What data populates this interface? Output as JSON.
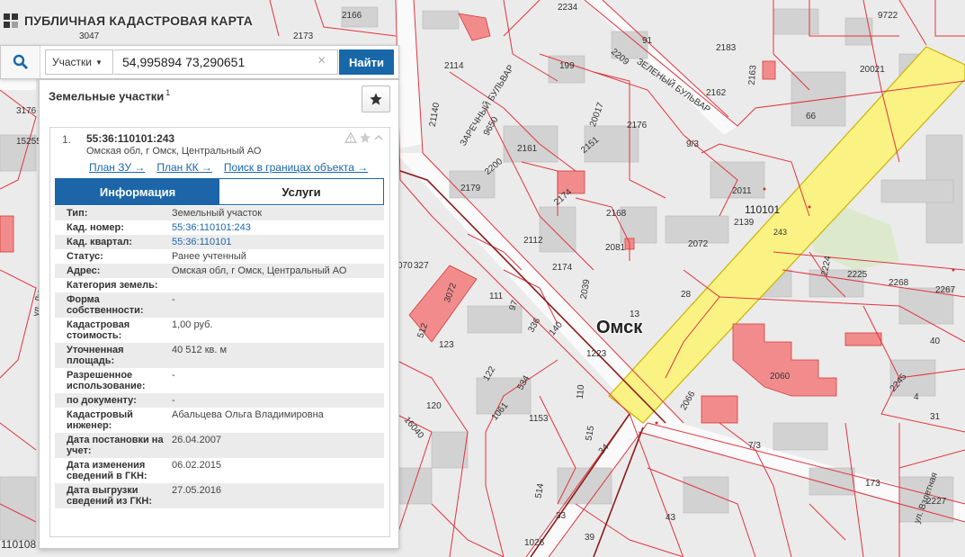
{
  "app": {
    "title": "ПУБЛИЧНАЯ КАДАСТРОВАЯ КАРТА"
  },
  "search": {
    "type_label": "Участки",
    "value": "54,995894 73,290651",
    "clear_symbol": "×",
    "button_label": "Найти"
  },
  "panel": {
    "title": "Земельные участки",
    "count": "1",
    "result": {
      "number": "1.",
      "cad_number": "55:36:110101:243",
      "address": "Омская обл, г Омск, Центральный АО",
      "links": [
        "План ЗУ →",
        "План КК →",
        "Поиск в границах объекта →"
      ],
      "tabs": [
        "Информация",
        "Услуги"
      ],
      "rows": [
        {
          "label": "Тип:",
          "value": "Земельный участок",
          "link": false
        },
        {
          "label": "Кад. номер:",
          "value": "55:36:110101:243",
          "link": true
        },
        {
          "label": "Кад. квартал:",
          "value": "55:36:110101",
          "link": true
        },
        {
          "label": "Статус:",
          "value": "Ранее учтенный",
          "link": false
        },
        {
          "label": "Адрес:",
          "value": "Омская обл, г Омск, Центральный АО",
          "link": false
        },
        {
          "label": "Категория земель:",
          "value": "",
          "link": false
        },
        {
          "label": "Форма собственности:",
          "value": "-",
          "link": false
        },
        {
          "label": "Кадастровая стоимость:",
          "value": "1,00 руб.",
          "link": false
        },
        {
          "label": "Уточненная площадь:",
          "value": "40 512 кв. м",
          "link": false
        },
        {
          "label": "Разрешенное использование:",
          "value": "-",
          "link": false
        },
        {
          "label": "по документу:",
          "value": "-",
          "link": false
        },
        {
          "label": "Кадастровый инженер:",
          "value": "Абальцева Ольга Владимировна",
          "link": false
        },
        {
          "label": "Дата постановки на учет:",
          "value": "26.04.2007",
          "link": false
        },
        {
          "label": "Дата изменения сведений в ГКН:",
          "value": "06.02.2015",
          "link": false
        },
        {
          "label": "Дата выгрузки сведений из ГКН:",
          "value": "27.05.2016",
          "link": false
        }
      ]
    }
  },
  "map": {
    "city_label": "Омск",
    "quarter_label": "110101",
    "colors": {
      "parcel_line": "#e0353f",
      "building": "#d0d0d0",
      "highlight": "#fbf284",
      "red_building": "#f08080"
    },
    "labels": [
      "2166",
      "2234",
      "3047",
      "2173",
      "2114",
      "9722",
      "91",
      "2183",
      "199",
      "2209",
      "2163",
      "20021",
      "ЗЕЛЕНЫЙ БУЛЬВАР",
      "2162",
      "3176",
      "21140",
      "ЗАРЕЧНЫЙ БУЛЬВАР",
      "20017",
      "15255",
      "9650",
      "2176",
      "66",
      "2161",
      "2151",
      "2200",
      "9/3",
      "2179",
      "2174",
      "2011",
      "2168",
      "110101",
      "2112",
      "2081",
      "2139",
      "2072",
      "243",
      "2174",
      "2224",
      "2225",
      "2268",
      "2267",
      "070",
      "327",
      "2039",
      "ул. Лукашевича",
      "111",
      "13",
      "3072",
      "97",
      "336",
      "28",
      "512",
      "140",
      "40",
      "123",
      "1223",
      "122",
      "2060",
      "2245",
      "534",
      "110",
      "120",
      "2066",
      "1153",
      "31",
      "16040",
      "1061",
      "515",
      "7/3",
      "173",
      "4",
      "514",
      "2227",
      "33",
      "43",
      "1026",
      "39",
      "110108",
      "ул. Взлетная",
      "34"
    ]
  }
}
